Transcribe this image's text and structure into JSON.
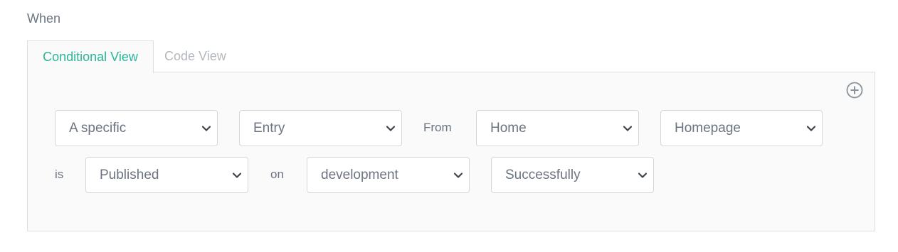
{
  "section": {
    "title": "When"
  },
  "tabs": [
    {
      "label": "Conditional View",
      "active": true
    },
    {
      "label": "Code View",
      "active": false
    }
  ],
  "add_button": {
    "icon": "plus-circle-icon"
  },
  "conditions": {
    "row1": {
      "subject": "A specific",
      "type": "Entry",
      "from_label": "From",
      "content_type": "Home",
      "entry": "Homepage"
    },
    "row2": {
      "is_label": "is",
      "event": "Published",
      "on_label": "on",
      "environment": "development",
      "status": "Successfully"
    }
  },
  "colors": {
    "accent": "#2cb59a",
    "text": "#6b7480",
    "border": "#dcdfe3",
    "panel_bg": "#fafafa"
  }
}
